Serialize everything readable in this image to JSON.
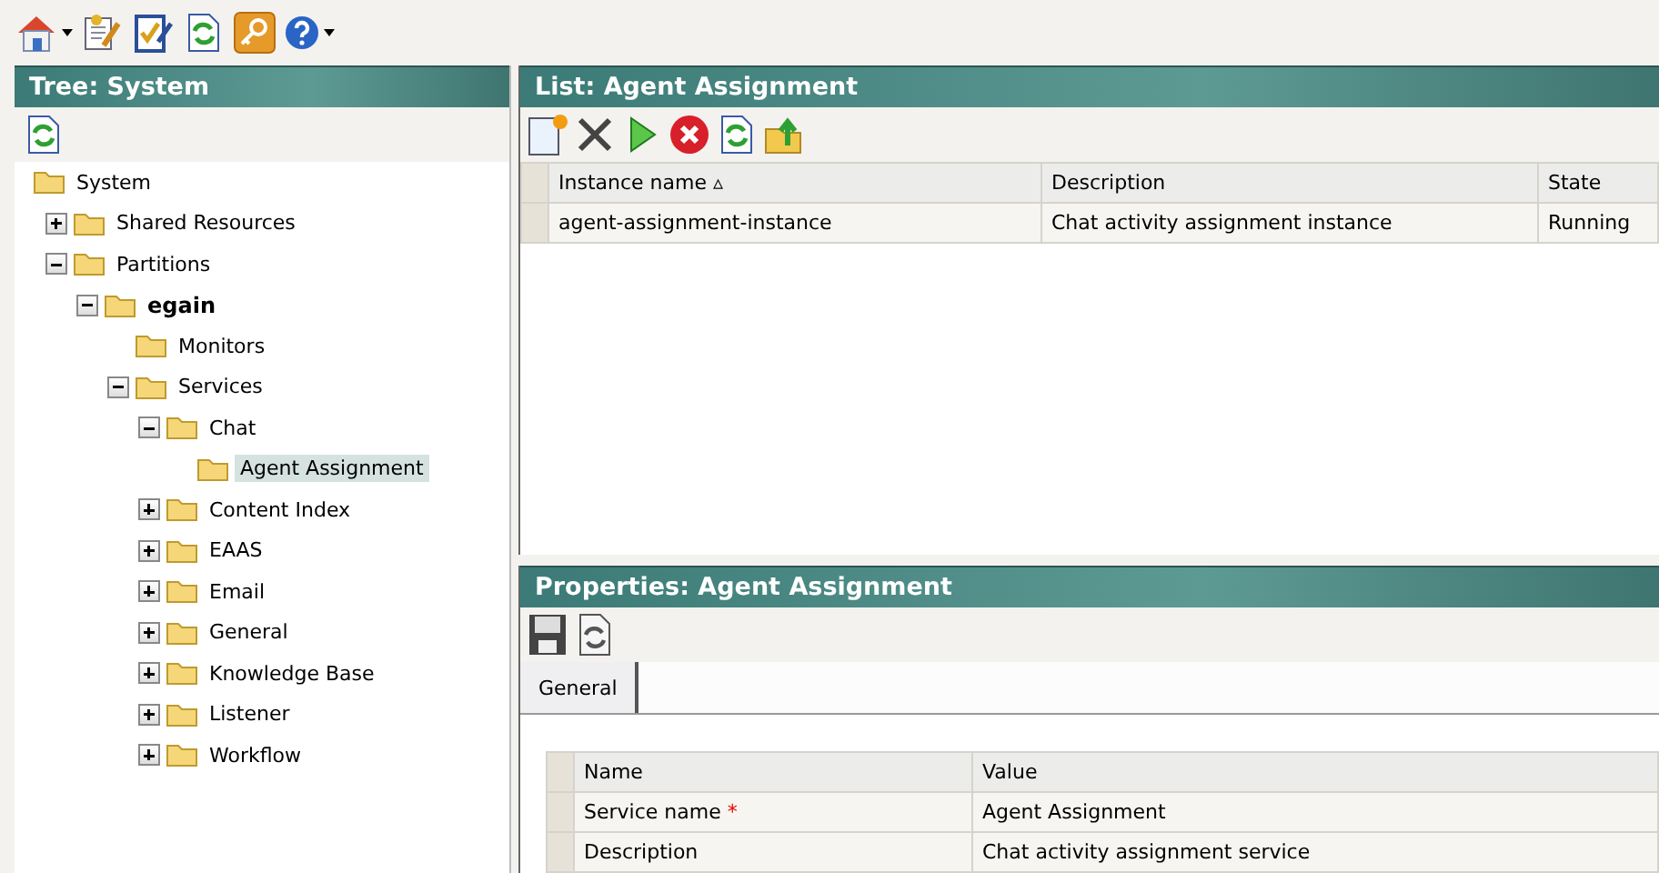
{
  "main_toolbar": {
    "buttons": [
      {
        "kind": "home",
        "dropdown": true
      },
      {
        "kind": "notes",
        "dropdown": false
      },
      {
        "kind": "clipboard",
        "dropdown": false
      },
      {
        "kind": "refresh",
        "dropdown": false
      },
      {
        "kind": "key",
        "dropdown": false
      },
      {
        "kind": "help",
        "dropdown": true
      }
    ]
  },
  "tree_pane": {
    "title": "Tree: System",
    "toolbar": [
      {
        "kind": "refresh"
      }
    ],
    "tree": [
      {
        "label": "System",
        "children": [
          {
            "label": "Shared Resources",
            "expanded": false
          },
          {
            "label": "Partitions",
            "expanded": true,
            "children": [
              {
                "label": "egain",
                "bold": true,
                "expanded": true,
                "children": [
                  {
                    "label": "Monitors"
                  },
                  {
                    "label": "Services",
                    "expanded": true,
                    "children": [
                      {
                        "label": "Chat",
                        "expanded": true,
                        "children": [
                          {
                            "label": "Agent Assignment",
                            "selected": true
                          }
                        ]
                      },
                      {
                        "label": "Content Index",
                        "expanded": false
                      },
                      {
                        "label": "EAAS",
                        "expanded": false
                      },
                      {
                        "label": "Email",
                        "expanded": false
                      },
                      {
                        "label": "General",
                        "expanded": false
                      },
                      {
                        "label": "Knowledge Base",
                        "expanded": false
                      },
                      {
                        "label": "Listener",
                        "expanded": false
                      },
                      {
                        "label": "Workflow",
                        "expanded": false
                      }
                    ]
                  }
                ]
              }
            ]
          }
        ]
      }
    ]
  },
  "list_pane": {
    "title": "List: Agent Assignment",
    "toolbar": [
      {
        "kind": "new"
      },
      {
        "kind": "delete"
      },
      {
        "kind": "start"
      },
      {
        "kind": "stop"
      },
      {
        "kind": "refresh"
      },
      {
        "kind": "export"
      }
    ],
    "columns": [
      {
        "label": "Instance name",
        "sort": "▵"
      },
      {
        "label": "Description"
      },
      {
        "label": "State"
      }
    ],
    "rows": [
      [
        "agent-assignment-instance",
        "Chat activity assignment instance",
        "Running"
      ]
    ]
  },
  "properties_pane": {
    "title": "Properties: Agent Assignment",
    "toolbar": [
      {
        "kind": "save"
      },
      {
        "kind": "revert"
      }
    ],
    "tabs": [
      {
        "label": "General",
        "selected": true
      }
    ],
    "columns": [
      "Name",
      "Value"
    ],
    "rows": [
      {
        "name": "Service name",
        "required_mark": "*",
        "value": "Agent Assignment"
      },
      {
        "name": "Description",
        "value": "Chat activity assignment service"
      }
    ]
  }
}
